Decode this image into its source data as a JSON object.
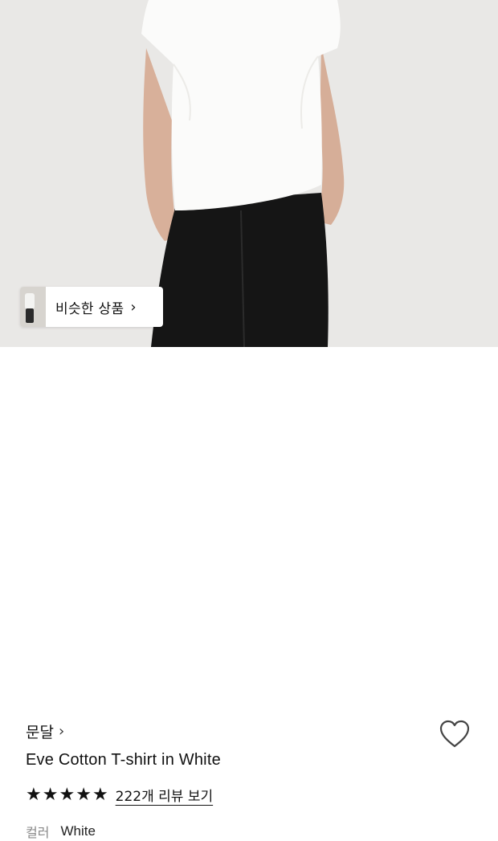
{
  "hero": {
    "alt_visible": "",
    "similar_chip": {
      "label": "비슷한 상품",
      "chevron": "›"
    }
  },
  "product": {
    "brand": "문달",
    "brand_chevron": "›",
    "title": "Eve Cotton T-shirt in White",
    "rating": {
      "stars": 5,
      "review_link": "222개 리뷰 보기"
    },
    "color": {
      "label": "컬러",
      "value": "White"
    },
    "wishlist_icon": "heart-outline-icon"
  },
  "colors": {
    "background": "#e9e8e6",
    "text": "#111111",
    "muted": "#888888"
  }
}
